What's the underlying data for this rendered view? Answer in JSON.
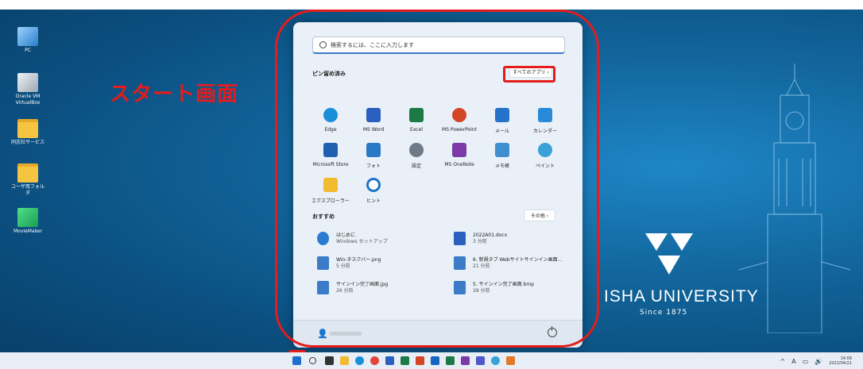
{
  "annotation": {
    "title": "スタート画面"
  },
  "desktop_icons": [
    {
      "label": "PC",
      "icon": "pc-icon"
    },
    {
      "label": "Oracle VM VirtualBox",
      "icon": "virtualbox-icon"
    },
    {
      "label": "同志社サービス",
      "icon": "folder-icon"
    },
    {
      "label": "ユーザ用フォルダ",
      "icon": "folder-icon"
    },
    {
      "label": "MovieMaker",
      "icon": "movie-icon"
    }
  ],
  "start_menu": {
    "search_placeholder": "検索するには、ここに入力します",
    "pinned_title": "ピン留め済み",
    "all_apps_label": "すべてのアプリ ›",
    "pinned_apps": [
      {
        "label": "Edge",
        "icon": "edge-icon",
        "color": "#1a8fd8"
      },
      {
        "label": "MS Word",
        "icon": "word-icon",
        "color": "#2b5fbf"
      },
      {
        "label": "Excel",
        "icon": "excel-icon",
        "color": "#1d7a46"
      },
      {
        "label": "MS PowerPoint",
        "icon": "powerpoint-icon",
        "color": "#d24625"
      },
      {
        "label": "メール",
        "icon": "mail-icon",
        "color": "#2473c8"
      },
      {
        "label": "カレンダー",
        "icon": "calendar-icon",
        "color": "#2a8ad8"
      },
      {
        "label": "Microsoft Store",
        "icon": "store-icon",
        "color": "#2060b0"
      },
      {
        "label": "フォト",
        "icon": "photos-icon",
        "color": "#2a78c8"
      },
      {
        "label": "設定",
        "icon": "settings-gear-icon",
        "color": "#6e7a86"
      },
      {
        "label": "MS OneNote",
        "icon": "onenote-icon",
        "color": "#7b3aa8"
      },
      {
        "label": "メモ帳",
        "icon": "notepad-icon",
        "color": "#3f8fd0"
      },
      {
        "label": "ペイント",
        "icon": "paint-icon",
        "color": "#3aa0d8"
      },
      {
        "label": "エクスプローラー",
        "icon": "explorer-folder-icon",
        "color": "#f2bb30"
      },
      {
        "label": "ヒント",
        "icon": "tips-icon",
        "color": "#1f74c9"
      }
    ],
    "recommended_title": "おすすめ",
    "more_label": "その他 ›",
    "recommended": [
      {
        "name": "はじめに",
        "sub": "Windows セットアップ",
        "icon": "getstarted-icon",
        "color": "#2b7bd0"
      },
      {
        "name": "2022A01.docx",
        "sub": "3 分前",
        "icon": "word-file-icon",
        "color": "#2b5fbf"
      },
      {
        "name": "Win-タスクバー.png",
        "sub": "5 分前",
        "icon": "image-file-icon",
        "color": "#3b7bc8"
      },
      {
        "name": "6. 新規タブ Webサイトサインイン画面...",
        "sub": "21 分前",
        "icon": "image-file-icon",
        "color": "#3b7bc8"
      },
      {
        "name": "サインイン完了画面.jpg",
        "sub": "26 分前",
        "icon": "image-file-icon",
        "color": "#3b7bc8"
      },
      {
        "name": "5. サインイン完了画面.bmp",
        "sub": "28 分前",
        "icon": "image-file-icon",
        "color": "#3b7bc8"
      }
    ]
  },
  "wallpaper": {
    "university": "ISHA UNIVERSITY",
    "since": "Since 1875"
  },
  "taskbar": {
    "icons": [
      "start-icon",
      "search-icon",
      "taskview-icon",
      "explorer-icon",
      "edge-icon",
      "chrome-icon",
      "word-icon",
      "excel-icon",
      "powerpoint-icon",
      "outlook-icon",
      "excel-icon",
      "onenote-icon",
      "teams-icon",
      "paint-icon",
      "snip-icon"
    ],
    "tray_chevron": "^",
    "tray_ime": "A",
    "clock_time": "14:09",
    "clock_date": "2022/04/21"
  }
}
